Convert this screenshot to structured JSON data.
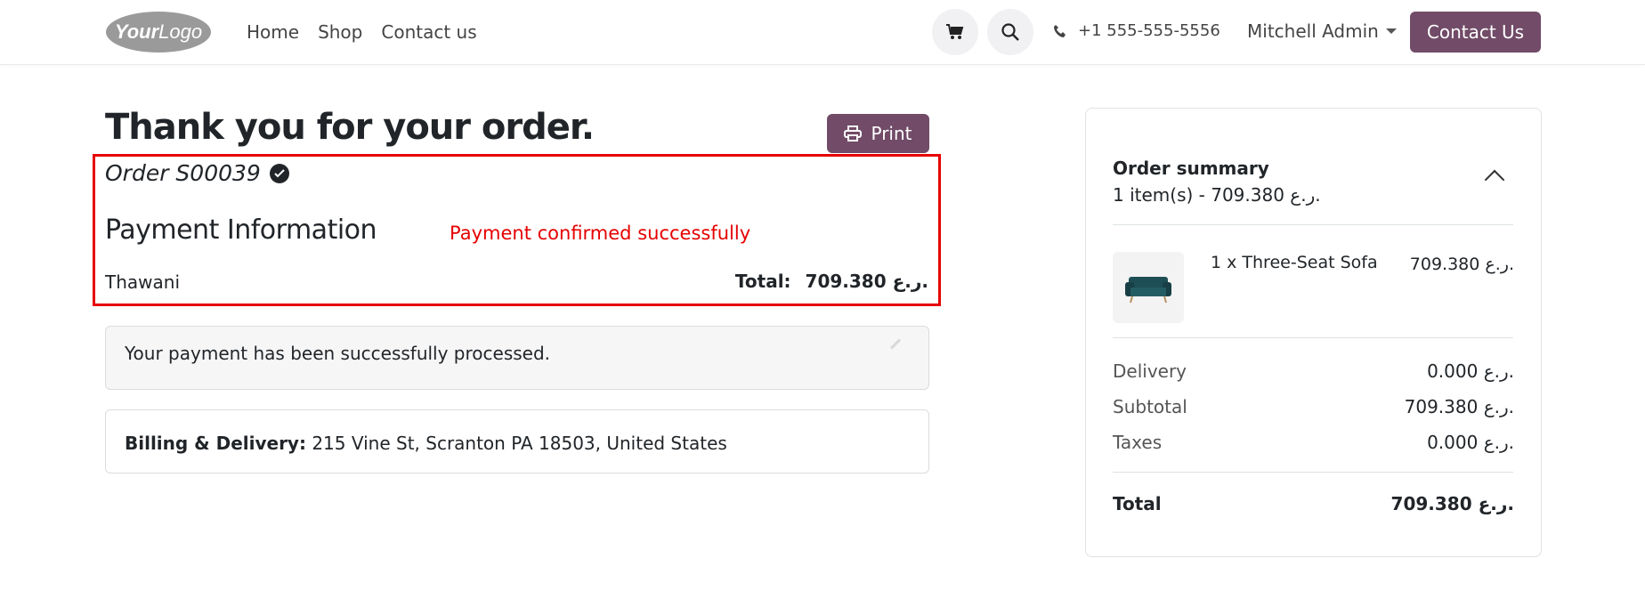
{
  "colors": {
    "brand": "#714b67",
    "highlight": "#e60000"
  },
  "header": {
    "logo_text": "YourLogo",
    "nav": [
      "Home",
      "Shop",
      "Contact us"
    ],
    "phone": "+1 555-555-5556",
    "user": "Mitchell Admin",
    "contact_button": "Contact Us"
  },
  "main": {
    "title": "Thank you for your order.",
    "print_label": "Print",
    "order_number": "Order S00039",
    "payment_heading": "Payment Information",
    "payment_note": "Payment confirmed successfully",
    "provider": "Thawani",
    "total_label": "Total:",
    "total_value": "709.380 ر.ع.",
    "message": "Your payment has been successfully processed.",
    "billing_label": "Billing & Delivery:",
    "billing_address": "215 Vine St, Scranton PA 18503, United States"
  },
  "summary": {
    "title": "Order summary",
    "subtitle": "1 item(s) -  709.380 ر.ع.",
    "item_name": "1 x Three-Seat Sofa",
    "item_price": "709.380 ر.ع.",
    "rows": [
      {
        "label": "Delivery",
        "value": "0.000 ر.ع."
      },
      {
        "label": "Subtotal",
        "value": "709.380 ر.ع."
      },
      {
        "label": "Taxes",
        "value": "0.000 ر.ع."
      }
    ],
    "total_label": "Total",
    "total_value": "709.380 ر.ع."
  }
}
